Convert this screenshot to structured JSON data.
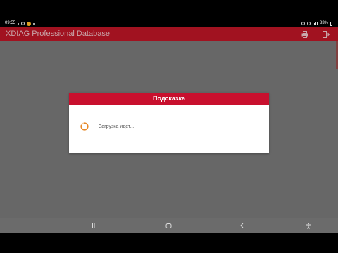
{
  "status_bar": {
    "time": "09:55",
    "battery": "83%"
  },
  "app_bar": {
    "title": "XDIAG Professional Database",
    "print_icon": "printer-icon",
    "exit_icon": "exit-icon"
  },
  "dialog": {
    "title": "Подсказка",
    "message": "Загрузка идет...",
    "spinner_icon": "loading-spinner-icon"
  },
  "nav_bar": {
    "recents_icon": "recents-icon",
    "home_icon": "home-icon",
    "back_icon": "back-icon",
    "accessibility_icon": "accessibility-icon"
  },
  "colors": {
    "app_bar": "#a11220",
    "dialog_header": "#c8102e",
    "spinner": "#e88a2a",
    "background": "#6b6b6b"
  }
}
